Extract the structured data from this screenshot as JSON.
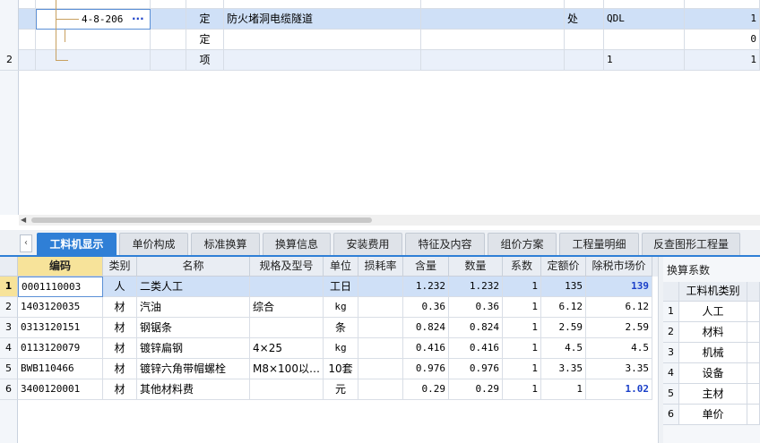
{
  "top_grid": {
    "rows": [
      {
        "num": "",
        "code": "",
        "type": "",
        "name": "",
        "unit": "",
        "qty": "",
        "val": ""
      },
      {
        "num": "",
        "code": "4-8-206",
        "more": "···",
        "type": "定",
        "name": "防火堵洞电缆隧道",
        "unit": "处",
        "qty": "QDL",
        "val": "1"
      },
      {
        "num": "",
        "code": "",
        "type": "定",
        "name": "",
        "unit": "",
        "qty": "",
        "val": "0"
      },
      {
        "num": "2",
        "code": "",
        "type": "项",
        "name": "",
        "unit": "",
        "qty": "1",
        "val": "1"
      }
    ]
  },
  "tabs": [
    {
      "label": "工料机显示",
      "active": true
    },
    {
      "label": "单价构成"
    },
    {
      "label": "标准换算"
    },
    {
      "label": "换算信息"
    },
    {
      "label": "安装费用"
    },
    {
      "label": "特征及内容"
    },
    {
      "label": "组价方案"
    },
    {
      "label": "工程量明细"
    },
    {
      "label": "反查图形工程量"
    }
  ],
  "bottom_grid": {
    "headers": [
      "编码",
      "类别",
      "名称",
      "规格及型号",
      "单位",
      "损耗率",
      "含量",
      "数量",
      "系数",
      "定额价",
      "除税市场价"
    ],
    "rows": [
      {
        "num": "1",
        "code": "0001110003",
        "cat": "人",
        "name": "二类人工",
        "spec": "",
        "unit": "工日",
        "loss": "",
        "content": "1.232",
        "qty": "1.232",
        "coef": "1",
        "price": "135",
        "market": "139",
        "market_bold": true
      },
      {
        "num": "2",
        "code": "1403120035",
        "cat": "材",
        "name": "汽油",
        "spec": "综合",
        "unit": "kg",
        "loss": "",
        "content": "0.36",
        "qty": "0.36",
        "coef": "1",
        "price": "6.12",
        "market": "6.12"
      },
      {
        "num": "3",
        "code": "0313120151",
        "cat": "材",
        "name": "钢锯条",
        "spec": "",
        "unit": "条",
        "loss": "",
        "content": "0.824",
        "qty": "0.824",
        "coef": "1",
        "price": "2.59",
        "market": "2.59"
      },
      {
        "num": "4",
        "code": "0113120079",
        "cat": "材",
        "name": "镀锌扁钢",
        "spec": "4×25",
        "unit": "kg",
        "loss": "",
        "content": "0.416",
        "qty": "0.416",
        "coef": "1",
        "price": "4.5",
        "market": "4.5"
      },
      {
        "num": "5",
        "code": "BWB110466",
        "cat": "材",
        "name": "镀锌六角带帽螺栓",
        "spec": "M8×100以…",
        "unit": "10套",
        "loss": "",
        "content": "0.976",
        "qty": "0.976",
        "coef": "1",
        "price": "3.35",
        "market": "3.35"
      },
      {
        "num": "6",
        "code": "3400120001",
        "cat": "材",
        "name": "其他材料费",
        "spec": "",
        "unit": "元",
        "loss": "",
        "content": "0.29",
        "qty": "0.29",
        "coef": "1",
        "price": "1",
        "market": "1.02",
        "market_bold": true
      }
    ]
  },
  "side_panel": {
    "title": "换算系数",
    "header": "工料机类别",
    "rows": [
      {
        "num": "1",
        "name": "人工"
      },
      {
        "num": "2",
        "name": "材料"
      },
      {
        "num": "3",
        "name": "机械"
      },
      {
        "num": "4",
        "name": "设备"
      },
      {
        "num": "5",
        "name": "主材"
      },
      {
        "num": "6",
        "name": "单价"
      }
    ]
  },
  "colors": {
    "accent": "#2f7fd6",
    "selected_row": "#cfe0f7",
    "alt_row": "#eaf0fa",
    "code_header": "#f7e39a",
    "price_blue": "#1a3fc8"
  }
}
